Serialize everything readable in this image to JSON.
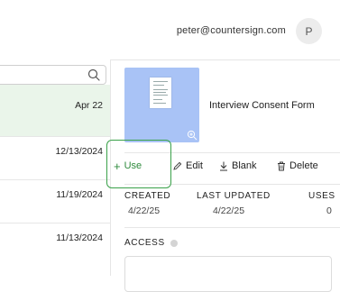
{
  "header": {
    "user_email": "peter@countersign.com",
    "avatar_initial": "P"
  },
  "search": {
    "placeholder": "",
    "value": ""
  },
  "document_list": [
    {
      "date": "Apr 22",
      "selected": true
    },
    {
      "date": "12/13/2024",
      "selected": false
    },
    {
      "date": "11/19/2024",
      "selected": false
    },
    {
      "date": "11/13/2024",
      "selected": false
    }
  ],
  "detail": {
    "title": "Interview Consent Form",
    "actions": {
      "use": "Use",
      "edit": "Edit",
      "blank": "Blank",
      "delete": "Delete"
    },
    "stats": {
      "created_label": "CREATED",
      "created_value": "4/22/25",
      "updated_label": "LAST UPDATED",
      "updated_value": "4/22/25",
      "uses_label": "USES",
      "uses_value": "0"
    },
    "access_label": "ACCESS"
  },
  "colors": {
    "accent": "#2e8a3c",
    "selected_row": "#eaf5ea",
    "thumbnail_bg": "#a9c3f6"
  }
}
